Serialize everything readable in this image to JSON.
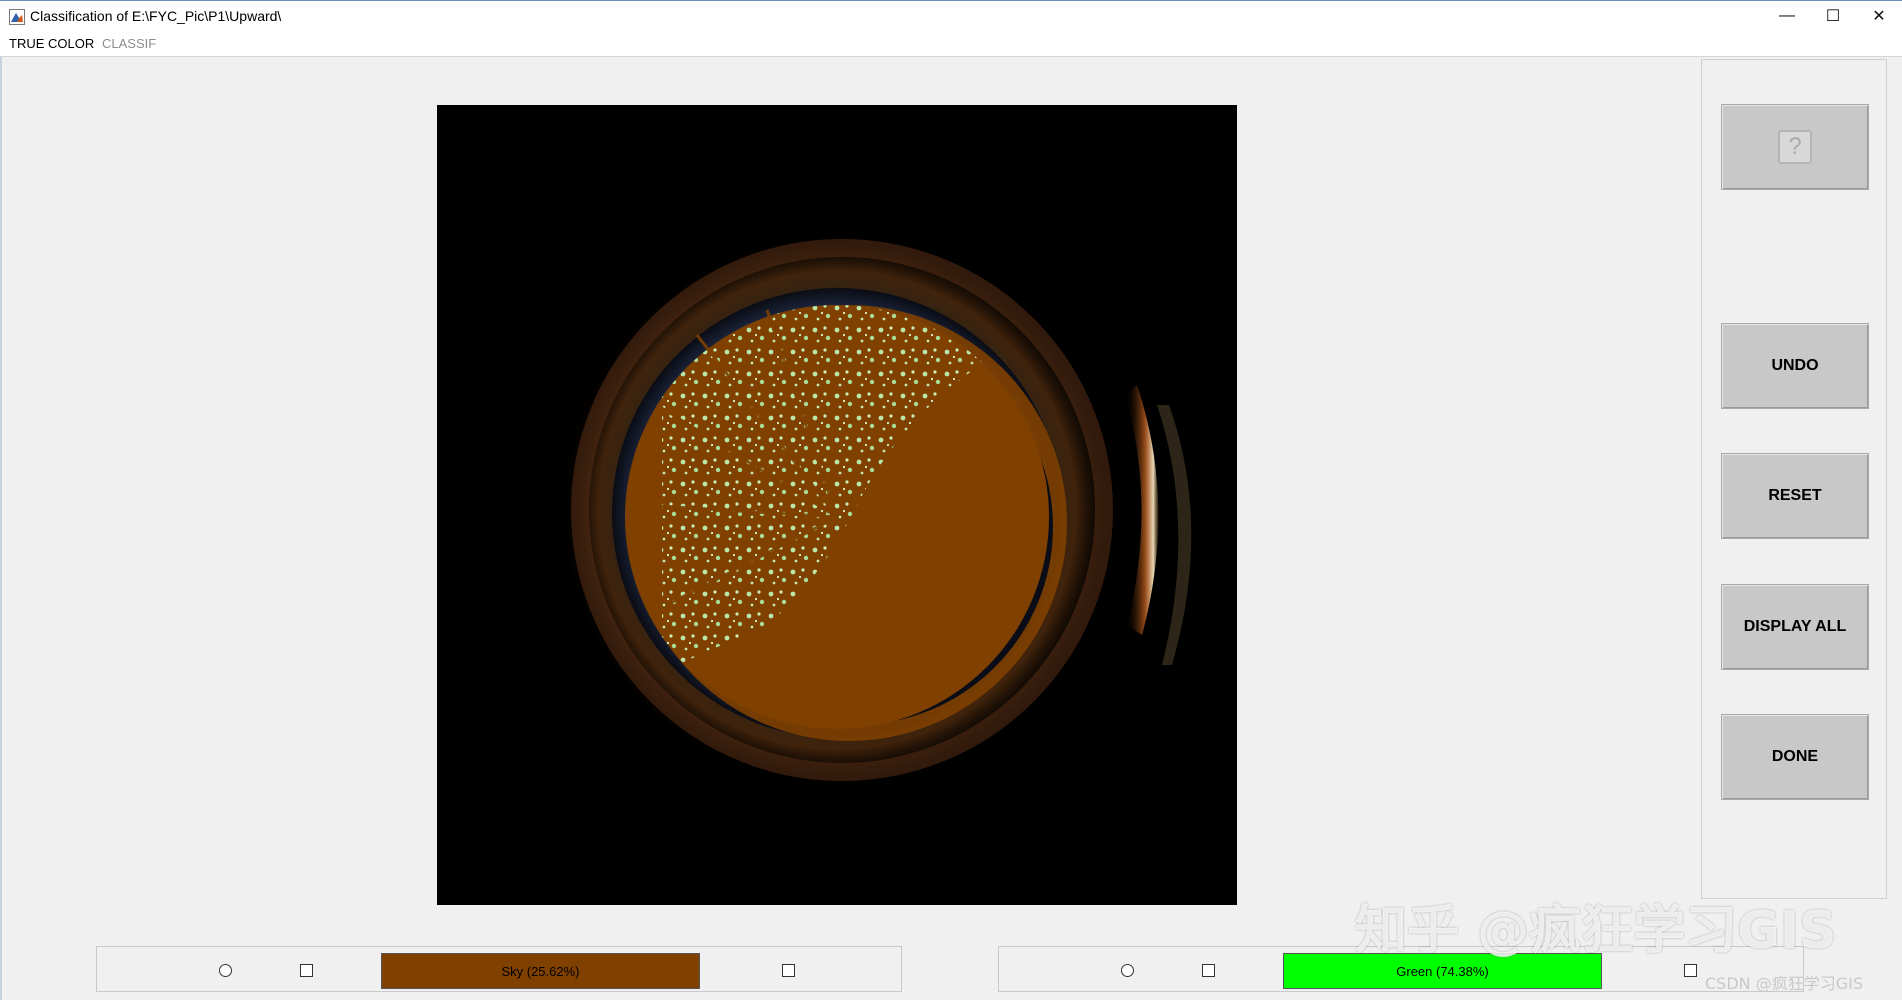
{
  "window": {
    "title": "Classification of E:\\FYC_Pic\\P1\\Upward\\",
    "icon": "matlab-figure-icon",
    "controls": {
      "minimize": "—",
      "maximize": "☐",
      "close": "✕"
    }
  },
  "menu": {
    "true_color": "TRUE COLOR",
    "classif": "CLASSIF"
  },
  "buttons": {
    "help": "?",
    "undo": "UNDO",
    "reset": "RESET",
    "display_all": "DISPLAY ALL",
    "done": "DONE"
  },
  "classes": [
    {
      "label": "Sky (25.62%)",
      "color": "#7f4000",
      "percent": 25.62
    },
    {
      "label": "Green (74.38%)",
      "color": "#00ff00",
      "percent": 74.38
    }
  ],
  "colors": {
    "sky_class": "#7f4000",
    "canopy_highlight": "#b9e8a8",
    "window_bg": "#f0f0f0"
  },
  "watermark": {
    "big": "知乎 @疯狂学习GIS",
    "small": "CSDN @疯狂学习GIS"
  }
}
